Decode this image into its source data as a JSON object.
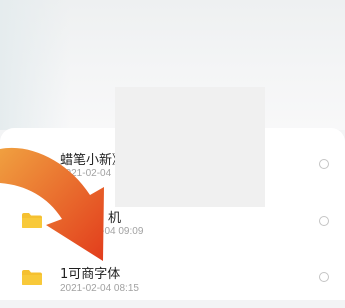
{
  "files": [
    {
      "name": "蜡笔小新》",
      "date": "2021-02-04"
    },
    {
      "name": "机",
      "date": "02-04 09:09"
    },
    {
      "name": "1可商字体",
      "date": "2021-02-04 08:15"
    }
  ],
  "icons": {
    "folder": "folder-icon",
    "radio": "radio-circle",
    "arrow": "arrow-annotation"
  },
  "colors": {
    "folder": "#f5c030",
    "arrow_start": "#f0a040",
    "arrow_end": "#e23c1c"
  }
}
